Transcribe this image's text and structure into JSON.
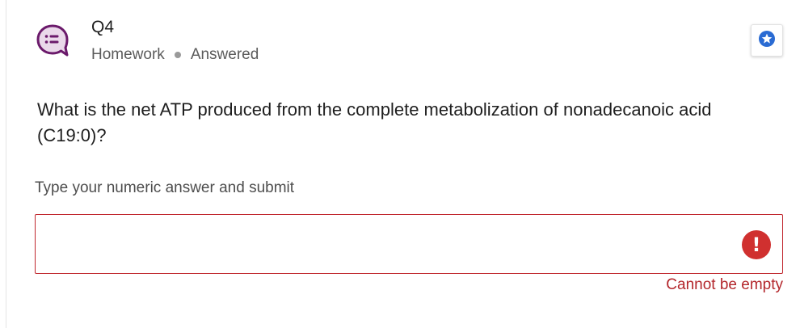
{
  "question": {
    "number": "Q4",
    "category": "Homework",
    "status": "Answered",
    "text": "What is the net ATP produced from the complete metabolization of nonadecanoic acid (C19:0)?"
  },
  "answer": {
    "prompt": "Type your numeric answer and submit",
    "value": "",
    "placeholder": "",
    "error_icon": "!",
    "error_message": "Cannot be empty"
  },
  "icons": {
    "question_type": "chat-list-icon",
    "bookmark": "star-badge-icon",
    "error": "exclamation-circle-icon"
  },
  "colors": {
    "icon_purple": "#6b1a6b",
    "icon_fill": "#ead9ea",
    "star_blue": "#2a6bd3",
    "error_red": "#c0262d"
  }
}
